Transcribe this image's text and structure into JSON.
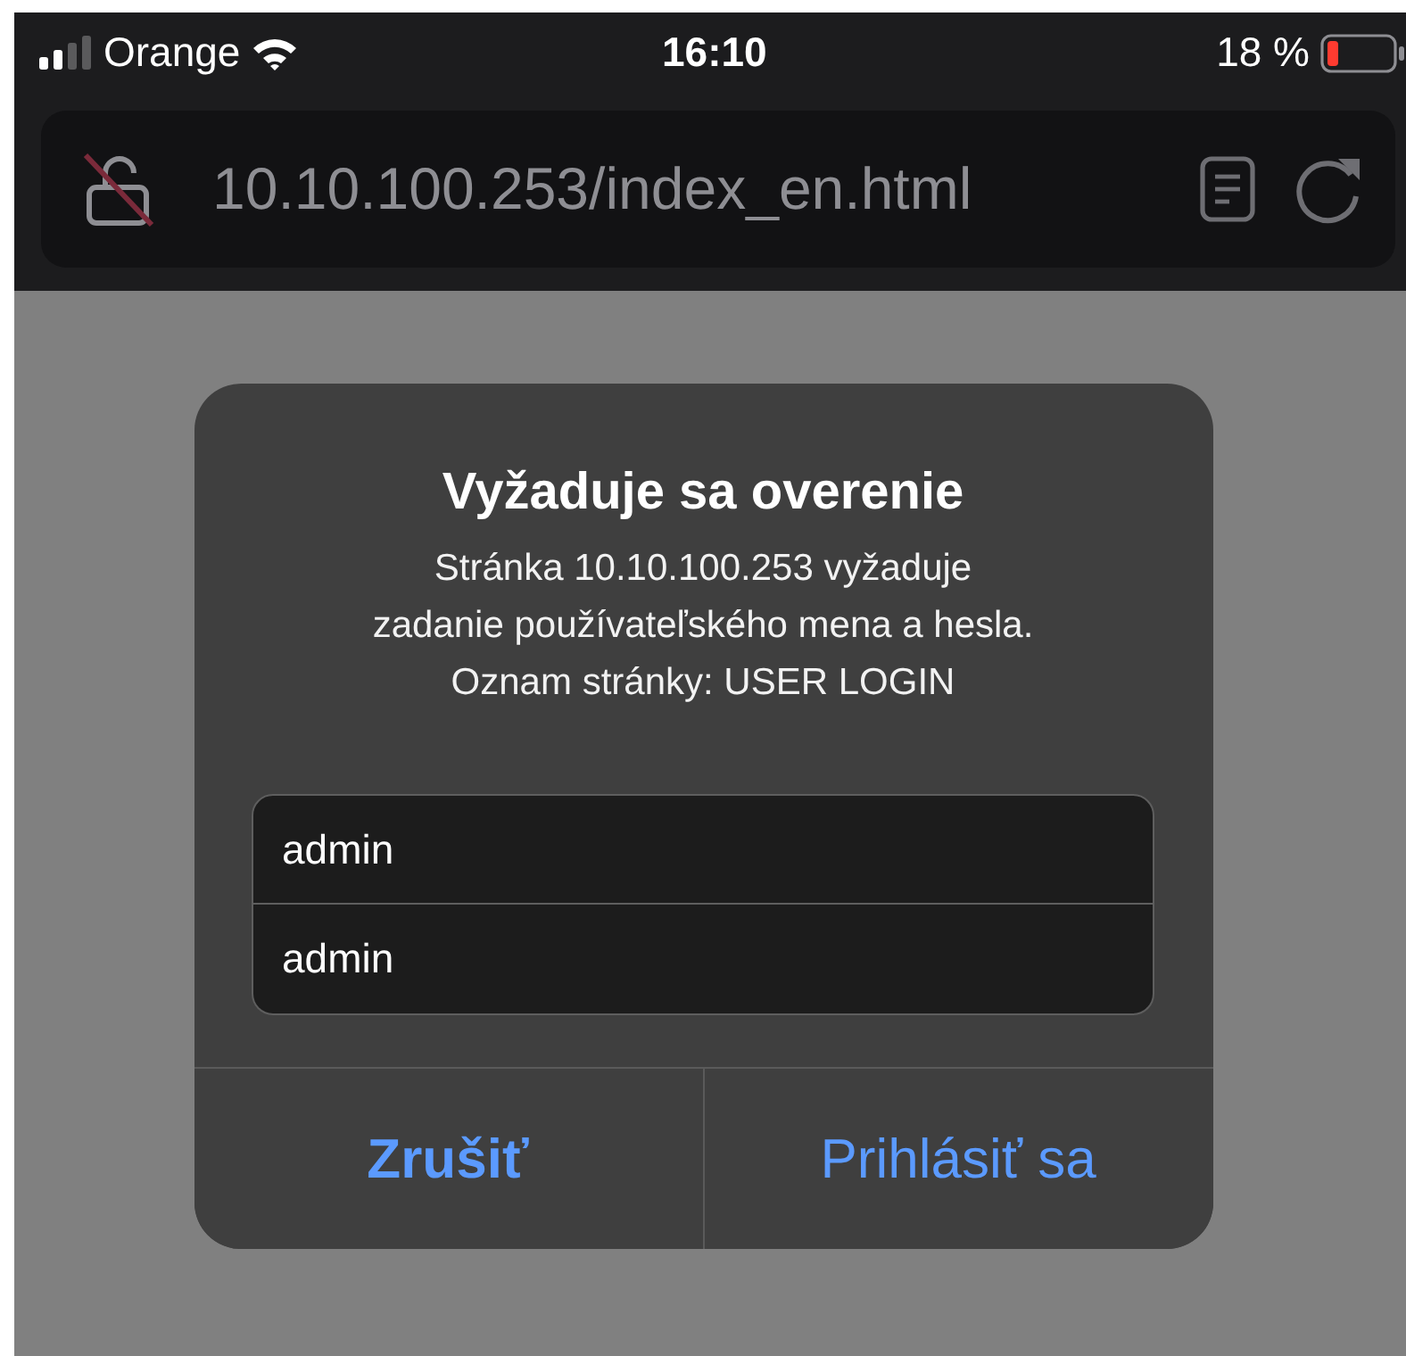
{
  "status_bar": {
    "carrier": "Orange",
    "time": "16:10",
    "battery": "18 %"
  },
  "address_bar": {
    "url": "10.10.100.253/index_en.html"
  },
  "dialog": {
    "title": "Vyžaduje sa overenie",
    "message": [
      "Stránka 10.10.100.253 vyžaduje",
      "zadanie používateľského mena a hesla.",
      "Oznam stránky: USER LOGIN"
    ],
    "fields": [
      {
        "value": "admin"
      },
      {
        "value": "admin"
      }
    ],
    "buttons": [
      {
        "label": "Zrušiť",
        "kind": "cancel"
      },
      {
        "label": "Prihlásiť sa",
        "kind": "default"
      }
    ]
  }
}
